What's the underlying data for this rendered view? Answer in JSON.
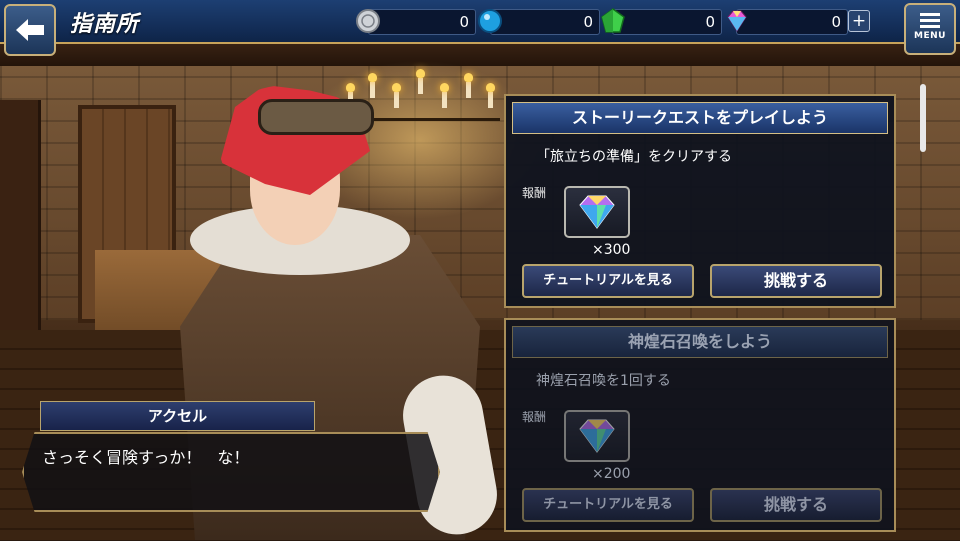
{
  "header": {
    "title": "指南所",
    "menu_label": "MENU"
  },
  "currencies": [
    {
      "name": "silver-coin",
      "value": "0"
    },
    {
      "name": "blue-orb",
      "value": "0"
    },
    {
      "name": "green-crystal",
      "value": "0"
    },
    {
      "name": "rainbow-gem",
      "value": "0"
    }
  ],
  "quests": [
    {
      "title": "ストーリークエストをプレイしよう",
      "description": "「旅立ちの準備」をクリアする",
      "reward_label": "報酬",
      "reward_icon": "rainbow-gem-icon",
      "reward_qty": "×300",
      "tutorial_label": "チュートリアルを見る",
      "challenge_label": "挑戦する",
      "state": "active"
    },
    {
      "title": "神煌石召喚をしよう",
      "description": "神煌石召喚を1回する",
      "reward_label": "報酬",
      "reward_icon": "rainbow-gem-icon",
      "reward_qty": "×200",
      "tutorial_label": "チュートリアルを見る",
      "challenge_label": "挑戦する",
      "state": "locked"
    }
  ],
  "dialogue": {
    "speaker": "アクセル",
    "text": "さっそく冒険すっか！　な！"
  },
  "colors": {
    "topbar": "#1d3f73",
    "gold_border": "#a88d58",
    "panel_bg": "#0e121e"
  }
}
